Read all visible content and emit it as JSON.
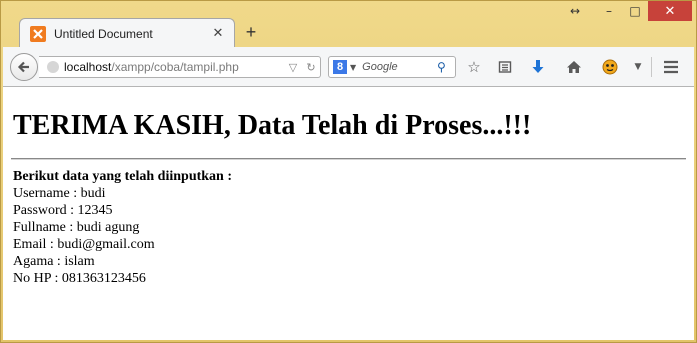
{
  "window": {
    "controls": {
      "resize": "↔",
      "minimize": "–",
      "maximize": "□",
      "close": "✕"
    }
  },
  "tab": {
    "title": "Untitled Document",
    "close": "✕",
    "new_tab": "+"
  },
  "navbar": {
    "url_host": "localhost",
    "url_path": "/xampp/coba/tampil.php",
    "search_engine": "8",
    "search_placeholder": "Google"
  },
  "page": {
    "heading": "TERIMA KASIH, Data Telah di Proses...!!!",
    "lead": "Berikut data yang telah diinputkan :",
    "fields": [
      "Username : budi",
      "Password : 12345",
      "Fullname : budi agung",
      "Email : budi@gmail.com",
      "Agama : islam",
      "No HP : 081363123456"
    ]
  },
  "colors": {
    "titlebar": "#e6c86f",
    "close_button": "#c7423a",
    "favicon": "#f07b1f",
    "download_arrow": "#1f74d6"
  }
}
